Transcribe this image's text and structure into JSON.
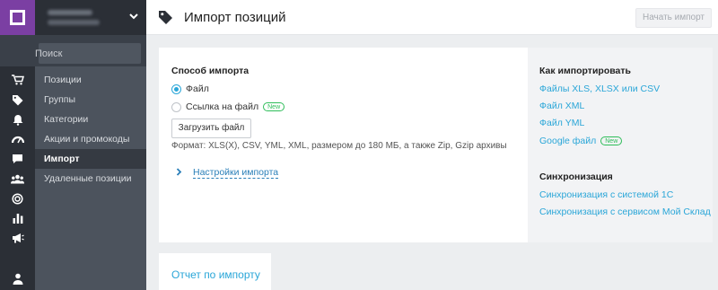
{
  "sidebar": {
    "search_placeholder": "Поиск",
    "items": [
      {
        "label": "Позиции"
      },
      {
        "label": "Группы"
      },
      {
        "label": "Категории"
      },
      {
        "label": "Акции и промокоды"
      },
      {
        "label": "Импорт",
        "active": true
      },
      {
        "label": "Удаленные позиции"
      }
    ]
  },
  "rail_icons": [
    "cart-icon",
    "tag-icon",
    "bell-icon",
    "gauge-icon",
    "chat-icon",
    "users-icon",
    "target-icon",
    "bar-chart-icon",
    "megaphone-icon",
    "person-icon"
  ],
  "header": {
    "title": "Импорт позиций",
    "start_button": "Начать импорт"
  },
  "import": {
    "method_heading": "Способ импорта",
    "option_file": "Файл",
    "option_link": "Ссылка на файл",
    "new_badge": "New",
    "upload_button": "Загрузить файл",
    "format_text": "Формат: XLS(X), CSV, YML, XML, размером до 180 МБ, а также Zip, Gzip архивы",
    "settings_link": "Настройки импорта",
    "selected_option": "Файл"
  },
  "help": {
    "how_heading": "Как импортировать",
    "links": [
      "Файлы XLS, XLSX или CSV",
      "Файл XML",
      "Файл YML",
      "Google файл"
    ],
    "google_badge": "New",
    "sync_heading": "Синхронизация",
    "sync_links": [
      "Синхронизация с системой 1С",
      "Синхронизация с сервисом Мой Склад"
    ]
  },
  "report": {
    "label": "Отчет по импорту"
  },
  "colors": {
    "accent": "#2aa6d8",
    "brand": "#7b3fa3",
    "new_badge": "#2ebd59"
  }
}
